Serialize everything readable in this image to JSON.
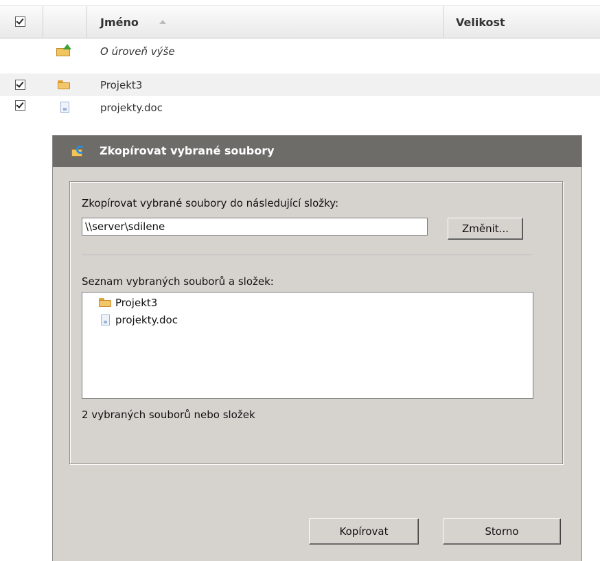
{
  "file_list": {
    "header": {
      "name_col": "Jméno",
      "size_col": "Velikost",
      "select_all_checked": true
    },
    "rows": [
      {
        "label": "O úroveň výše",
        "icon": "folder-up-icon",
        "checked": false
      },
      {
        "label": "Projekt3",
        "icon": "folder-icon",
        "checked": true
      },
      {
        "label": "projekty.doc",
        "icon": "doc-icon",
        "checked": true
      }
    ]
  },
  "dialog": {
    "title": "Zkopírovat vybrané soubory",
    "dest_label": "Zkopírovat vybrané soubory do následující složky:",
    "dest_value": "\\\\server\\sdilene",
    "change_button": "Změnit...",
    "list_label": "Seznam vybraných souborů a složek:",
    "items": [
      {
        "label": "Projekt3",
        "icon": "folder-icon"
      },
      {
        "label": "projekty.doc",
        "icon": "doc-icon"
      }
    ],
    "count_text": "2 vybraných souborů nebo složek",
    "copy_button": "Kopírovat",
    "cancel_button": "Storno"
  },
  "colors": {
    "title_bar": "#6e6c68",
    "dialog_bg": "#d6d3ce",
    "row_alt": "#f1f1f1"
  }
}
